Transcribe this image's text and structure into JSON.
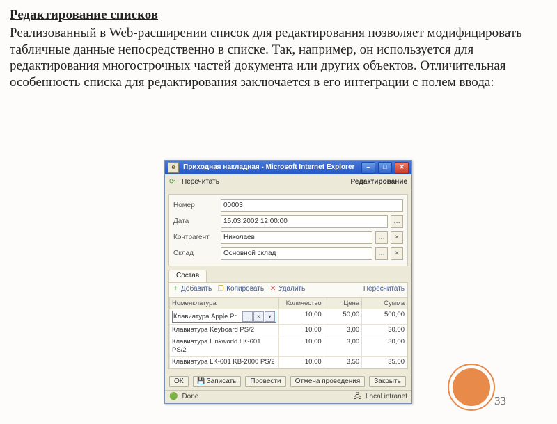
{
  "slide": {
    "heading": "Редактирование списков",
    "paragraph": "Реализованный в Web-расширении список для редактирования позволяет модифицировать табличные данные непосредственно в списке. Так, например, он используется для редактирования многострочных частей документа или других объектов. Отличительная особенность списка для редактирования заключается в его интеграции с полем ввода:",
    "page": "33"
  },
  "app": {
    "title": "Приходная накладная - Microsoft Internet Explorer",
    "toolbar": {
      "reload": "Перечитать",
      "mode": "Редактирование"
    },
    "form": {
      "fields": [
        {
          "label": "Номер",
          "value": "00003",
          "browse": false
        },
        {
          "label": "Дата",
          "value": "15.03.2002 12:00:00",
          "browse": true
        },
        {
          "label": "Контрагент",
          "value": "Николаев",
          "browse": true,
          "clear": true
        },
        {
          "label": "Склад",
          "value": "Основной склад",
          "browse": true,
          "clear": true
        }
      ]
    },
    "tab": "Состав",
    "list": {
      "actions": {
        "add": "Добавить",
        "copy": "Копировать",
        "del": "Удалить",
        "recalc": "Пересчитать"
      },
      "columns": [
        "Номенклатура",
        "Количество",
        "Цена",
        "Сумма"
      ],
      "rows": [
        {
          "name": "Клавиатура Apple Pr",
          "qty": "10,00",
          "price": "50,00",
          "sum": "500,00",
          "editing": true
        },
        {
          "name": "Клавиатура Keyboard PS/2",
          "qty": "10,00",
          "price": "3,00",
          "sum": "30,00"
        },
        {
          "name": "Клавиатура Linkworld LK-601 PS/2",
          "qty": "10,00",
          "price": "3,00",
          "sum": "30,00"
        },
        {
          "name": "Клавиатура LK-601 KB-2000 PS/2",
          "qty": "10,00",
          "price": "3,50",
          "sum": "35,00"
        }
      ]
    },
    "buttons": {
      "ok": "ОК",
      "save": "Записать",
      "post": "Провести",
      "unpost": "Отмена проведения",
      "close": "Закрыть"
    },
    "status": {
      "done": "Done",
      "zone": "Local intranet"
    }
  }
}
